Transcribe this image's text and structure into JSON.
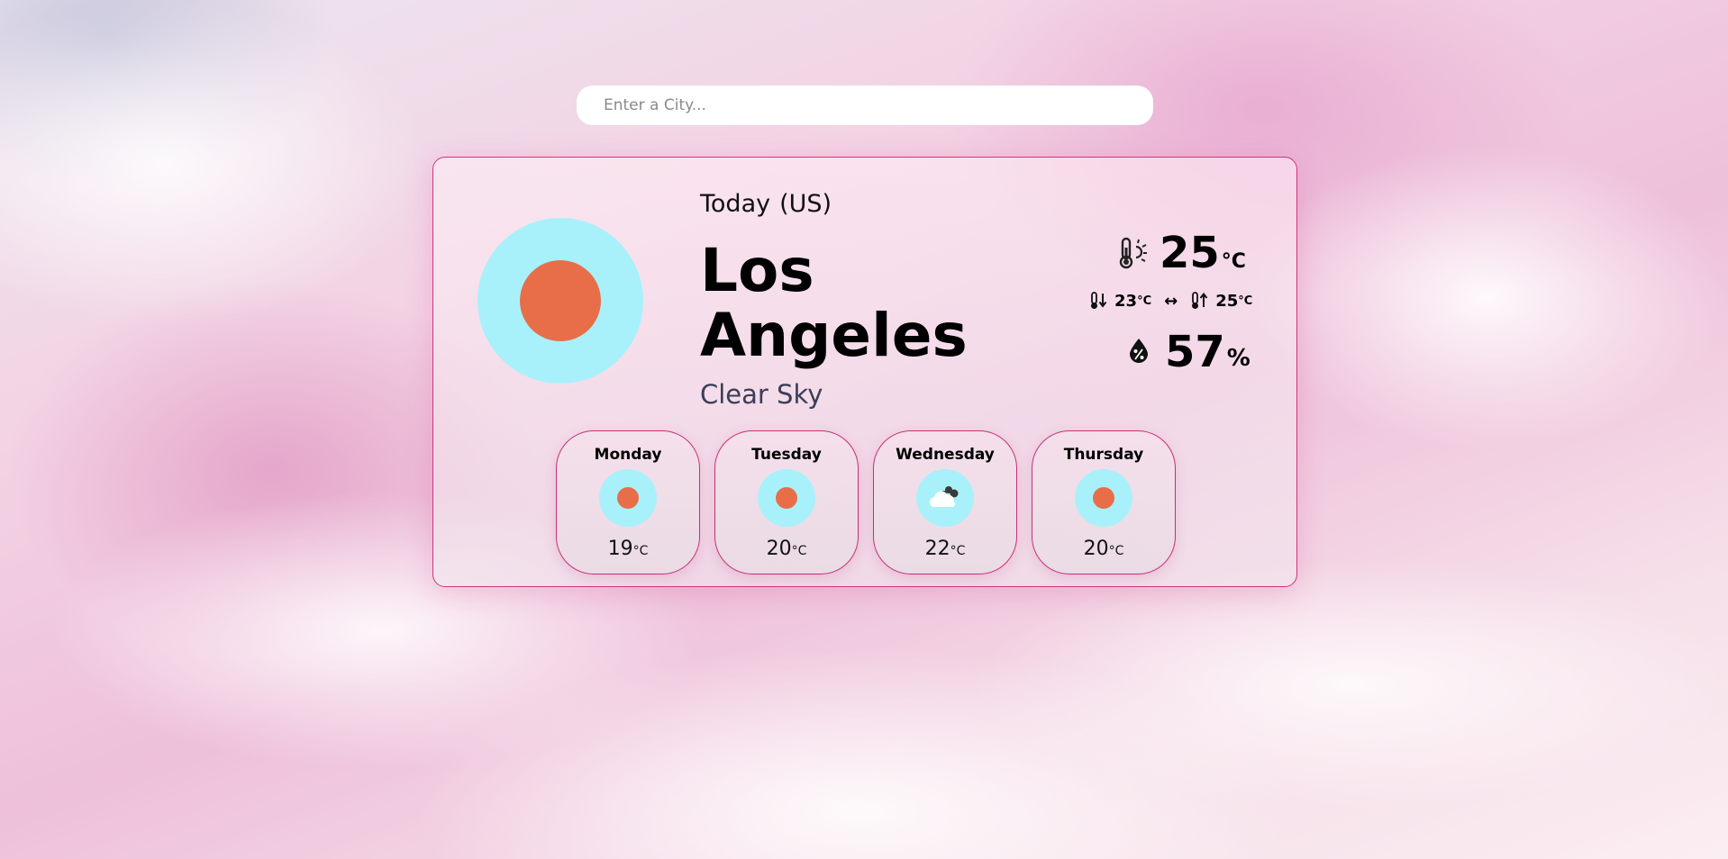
{
  "search": {
    "placeholder": "Enter a City..."
  },
  "current": {
    "today_label": "Today",
    "country": "(US)",
    "city": "Los Angeles",
    "condition": "Clear Sky",
    "temperature": "25",
    "temp_unit": "°C",
    "min_temp": "23",
    "max_temp": "25",
    "minmax_unit": "°C",
    "range_arrow": "↔",
    "humidity": "57",
    "humidity_unit": "%",
    "icon": "sun-icon"
  },
  "forecast": [
    {
      "day": "Monday",
      "temp": "19",
      "unit": "°C",
      "icon": "sun-icon"
    },
    {
      "day": "Tuesday",
      "temp": "20",
      "unit": "°C",
      "icon": "sun-icon"
    },
    {
      "day": "Wednesday",
      "temp": "22",
      "unit": "°C",
      "icon": "cloud-icon"
    },
    {
      "day": "Thursday",
      "temp": "20",
      "unit": "°C",
      "icon": "sun-icon"
    }
  ],
  "colors": {
    "accent_border": "#d0357a",
    "icon_bg": "#a8f1fb",
    "sun": "#e86e4a",
    "condition_text": "#3a3e58"
  }
}
